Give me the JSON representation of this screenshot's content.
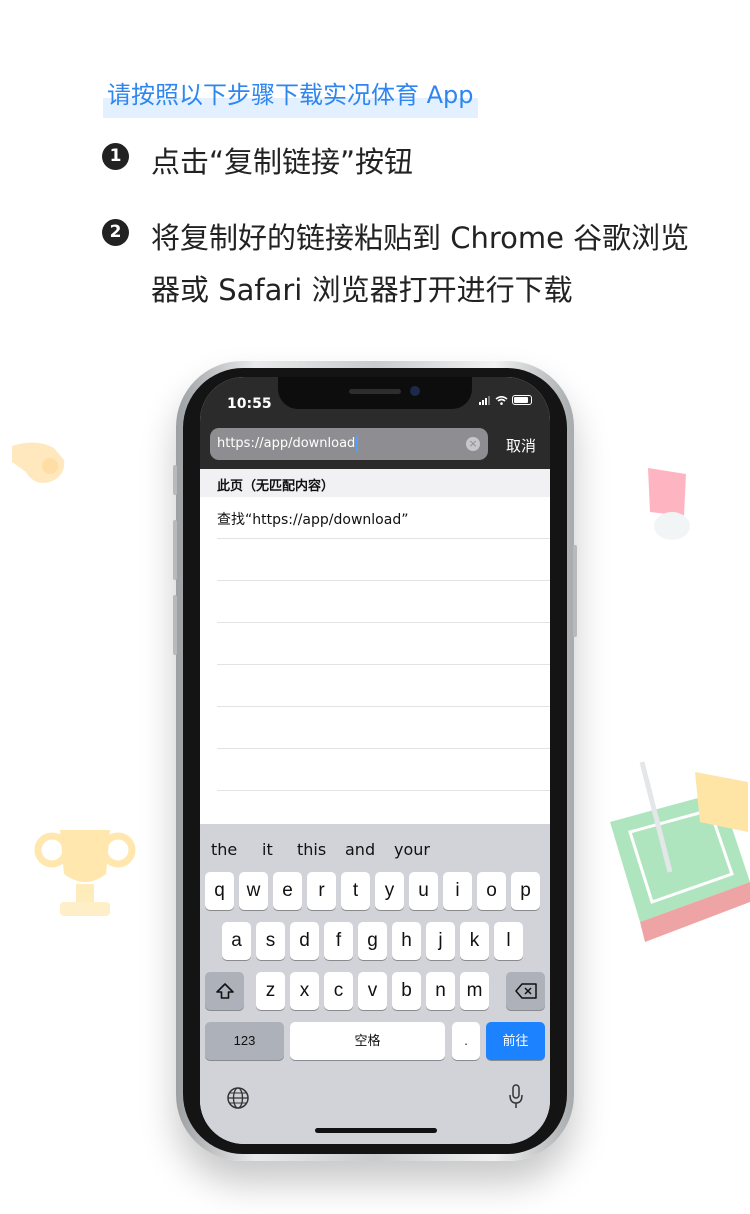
{
  "header": {
    "instruction": "请按照以下步骤下载实况体育 App"
  },
  "steps": [
    {
      "number": "1",
      "text": "点击“复制链接”按钮"
    },
    {
      "number": "2",
      "text": "将复制好的链接粘贴到 Chrome 谷歌浏览器或 Safari 浏览器打开进行下载"
    }
  ],
  "phone": {
    "status": {
      "time": "10:55"
    },
    "url_field": {
      "value": "https://app/download"
    },
    "cancel_label": "取消",
    "section_title": "此页（无匹配内容）",
    "suggestions": [
      "查找“https://app/download”",
      "",
      "",
      "",
      "",
      "",
      ""
    ],
    "keyboard": {
      "predictions": [
        "the",
        "it",
        "this",
        "and",
        "your"
      ],
      "row1": [
        "q",
        "w",
        "e",
        "r",
        "t",
        "y",
        "u",
        "i",
        "o",
        "p"
      ],
      "row2": [
        "a",
        "s",
        "d",
        "f",
        "g",
        "h",
        "j",
        "k",
        "l"
      ],
      "row3": [
        "z",
        "x",
        "c",
        "v",
        "b",
        "n",
        "m"
      ],
      "numbers_label": "123",
      "space_label": "空格",
      "period_label": ".",
      "go_label": "前往"
    }
  },
  "colors": {
    "accent": "#2f86f0",
    "highlight": "#e3f0ff",
    "go_key": "#1c82ff"
  }
}
